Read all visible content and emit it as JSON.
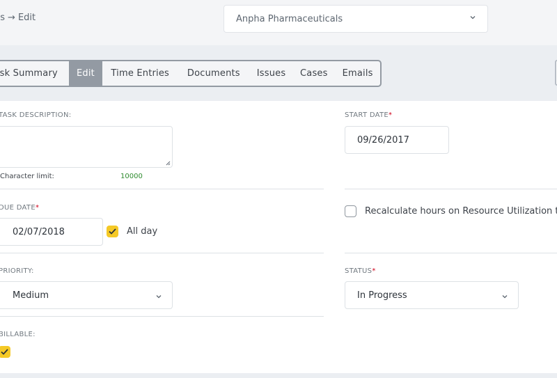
{
  "header": {
    "breadcrumb_parent": "asks",
    "breadcrumb_arrow": "→",
    "breadcrumb_current": "Edit",
    "company_value": "Anpha Pharmaceuticals"
  },
  "tabs": [
    {
      "label": "sk Summary"
    },
    {
      "label": "Edit"
    },
    {
      "label": "Time Entries"
    },
    {
      "label": "Documents"
    },
    {
      "label": "Issues"
    },
    {
      "label": "Cases"
    },
    {
      "label": "Emails"
    }
  ],
  "form": {
    "task_description": {
      "label": "TASK DESCRIPTION:",
      "value": "",
      "char_limit_label": "Character limit:",
      "char_limit_value": "10000"
    },
    "start_date": {
      "label": "START DATE",
      "required_mark": "*",
      "value": "09/26/2017"
    },
    "due_date": {
      "label": "DUE DATE",
      "required_mark": "*",
      "value": "02/07/2018",
      "all_day_label": "All day",
      "all_day_checked": true
    },
    "recalculate": {
      "label": "Recalculate hours on Resource Utilization te",
      "checked": false
    },
    "priority": {
      "label": "PRIORITY:",
      "value": "Medium"
    },
    "status": {
      "label": "STATUS",
      "required_mark": "*",
      "value": "In Progress"
    },
    "billable": {
      "label": "BILLABLE:",
      "checked": true
    }
  },
  "colors": {
    "accent_checkbox": "#f5c926",
    "active_tab": "#939aa3",
    "required": "#d0021b",
    "char_limit": "#2e8b2e"
  },
  "icons": {
    "chevron": "chevron-down-icon",
    "check": "check-icon"
  }
}
